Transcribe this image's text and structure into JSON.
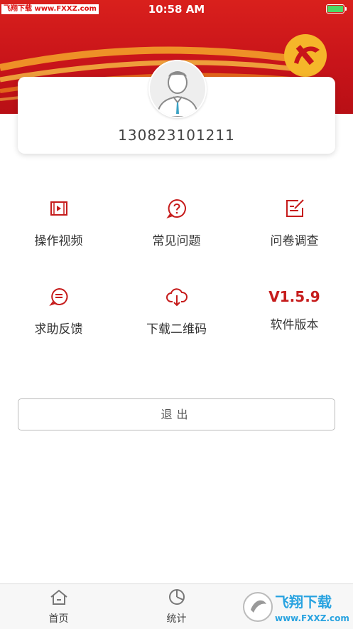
{
  "status_bar": {
    "watermark": "飞翔下载 www.FXXZ.com",
    "time": "10:58 AM"
  },
  "profile": {
    "phone": "130823101211"
  },
  "grid": [
    {
      "label": "操作视频",
      "icon": "video-icon"
    },
    {
      "label": "常见问题",
      "icon": "question-icon"
    },
    {
      "label": "问卷调查",
      "icon": "survey-icon"
    },
    {
      "label": "求助反馈",
      "icon": "feedback-icon"
    },
    {
      "label": "下载二维码",
      "icon": "cloud-download-icon"
    },
    {
      "label": "软件版本",
      "version": "V1.5.9"
    }
  ],
  "logout": {
    "label": "退出"
  },
  "tabbar": {
    "tabs": [
      {
        "label": "首页",
        "icon": "home-icon"
      },
      {
        "label": "统计",
        "icon": "pie-chart-icon"
      }
    ]
  },
  "watermark_br": {
    "text": "飞翔下载",
    "url": "www.FXXZ.com"
  },
  "colors": {
    "brand_red": "#c8141a",
    "icon_red": "#c61c1c"
  }
}
